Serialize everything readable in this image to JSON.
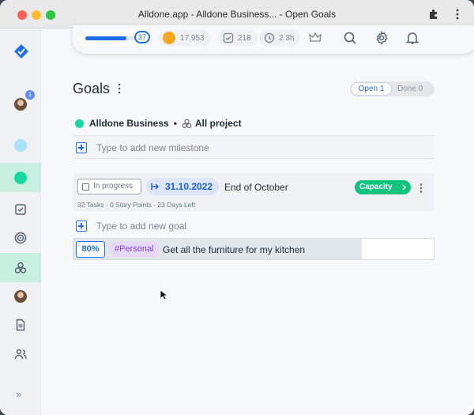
{
  "window": {
    "title": "Alldone.app - Alldone Business... - Open Goals"
  },
  "sidebar": {
    "notification_badge": "1",
    "expand_label": "»"
  },
  "topbar": {
    "progress_value": "37",
    "progress_fraction": 0.7,
    "gold": "17.953",
    "tasks": "218",
    "time": "2.3h"
  },
  "page": {
    "title": "Goals",
    "toggle_open": "Open 1",
    "toggle_done": "Done 0"
  },
  "project": {
    "name": "Alldone Business",
    "separator": "•",
    "scope": "All project",
    "color": "#16d9a0"
  },
  "milestone_add": {
    "placeholder": "Type to add new milestone"
  },
  "milestone": {
    "status": "In progress",
    "date": "31.10.2022",
    "name": "End of October",
    "meta": "32 Tasks · 0 Story Points · 23 Days Left",
    "capacity_label": "Capacity",
    "capacity_color": "#10c47d"
  },
  "goal_add": {
    "placeholder": "Type to add new goal"
  },
  "goal": {
    "progress": "80%",
    "progress_fraction": 0.8,
    "tag": "#Personal",
    "text": "Get all the furniture for my kitchen"
  },
  "colors": {
    "accent": "#1c6fe8",
    "active_nav": "#c9efe1"
  }
}
